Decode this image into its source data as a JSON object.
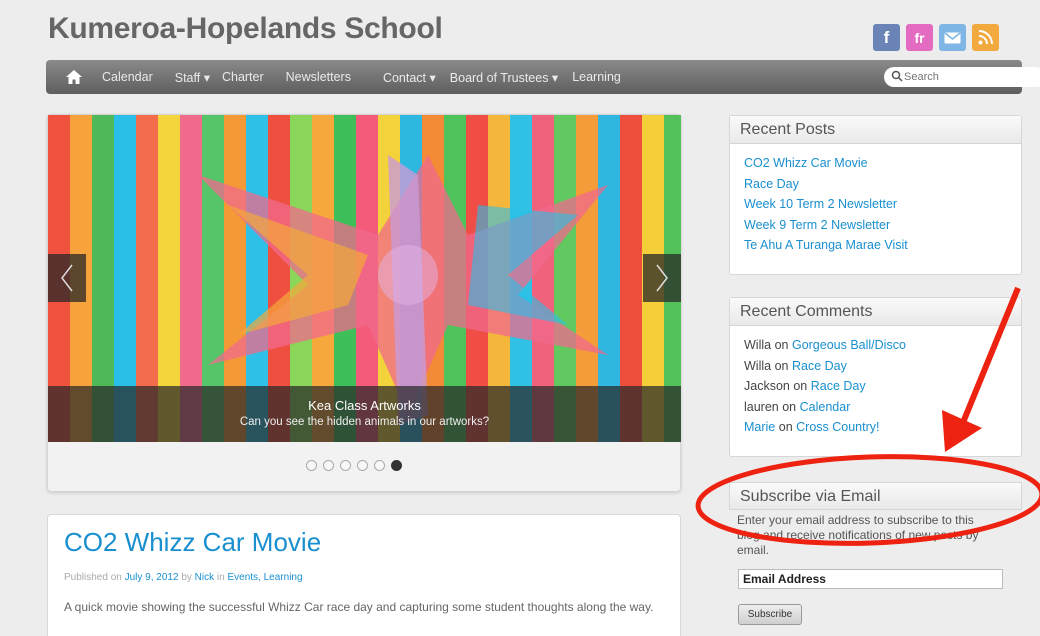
{
  "site": {
    "title": "Kumeroa-Hopelands School",
    "social": [
      {
        "icon": "facebook-icon",
        "glyph": "f",
        "color": "#6b84b7"
      },
      {
        "icon": "friendfeed-icon",
        "glyph": "fr",
        "color": "#e46bc2"
      },
      {
        "icon": "mail-icon",
        "glyph": "✉",
        "color": "#7fb6e6"
      },
      {
        "icon": "rss-icon",
        "glyph": "◔",
        "color": "#f2a93d"
      }
    ]
  },
  "nav": {
    "items": [
      "Calendar",
      "Staff ▾",
      "Charter",
      "Newsletters",
      "Contact ▾",
      "Board of Trustees ▾",
      "Learning"
    ],
    "search_placeholder": "Search"
  },
  "slider": {
    "caption_title": "Kea Class Artworks",
    "caption_sub": "Can you see the hidden animals in our artworks?",
    "dot_count": 6,
    "active_dot": 6
  },
  "post": {
    "title": "CO2 Whizz Car Movie",
    "meta_published": "Published on",
    "meta_date": "July 9, 2012",
    "meta_by": "by",
    "meta_author": "Nick",
    "meta_in": "in",
    "meta_categories": "Events, Learning",
    "excerpt": "A quick movie showing the successful Whizz Car race day and capturing some student thoughts along the way."
  },
  "recent_posts": {
    "title": "Recent Posts",
    "items": [
      "CO2 Whizz Car Movie",
      "Race Day",
      "Week 10 Term 2 Newsletter",
      "Week 9 Term 2 Newsletter",
      "Te Ahu A Turanga Marae Visit"
    ]
  },
  "recent_comments": {
    "title": "Recent Comments",
    "items": [
      {
        "author": "Willa",
        "on": "on",
        "post": "Gorgeous Ball/Disco",
        "author_link": false
      },
      {
        "author": "Willa",
        "on": "on",
        "post": "Race Day",
        "author_link": false
      },
      {
        "author": "Jackson",
        "on": "on",
        "post": "Race Day",
        "author_link": false
      },
      {
        "author": "lauren",
        "on": "on",
        "post": "Calendar",
        "author_link": false
      },
      {
        "author": "Marie",
        "on": "on",
        "post": "Cross Country!",
        "author_link": true
      }
    ]
  },
  "subscribe": {
    "title": "Subscribe via Email",
    "description": "Enter your email address to subscribe to this blog and receive notifications of new posts by email.",
    "input_value": "Email Address",
    "button_label": "Subscribe"
  },
  "colors": {
    "link": "#1a8fd0",
    "annotation": "#ee2211"
  }
}
